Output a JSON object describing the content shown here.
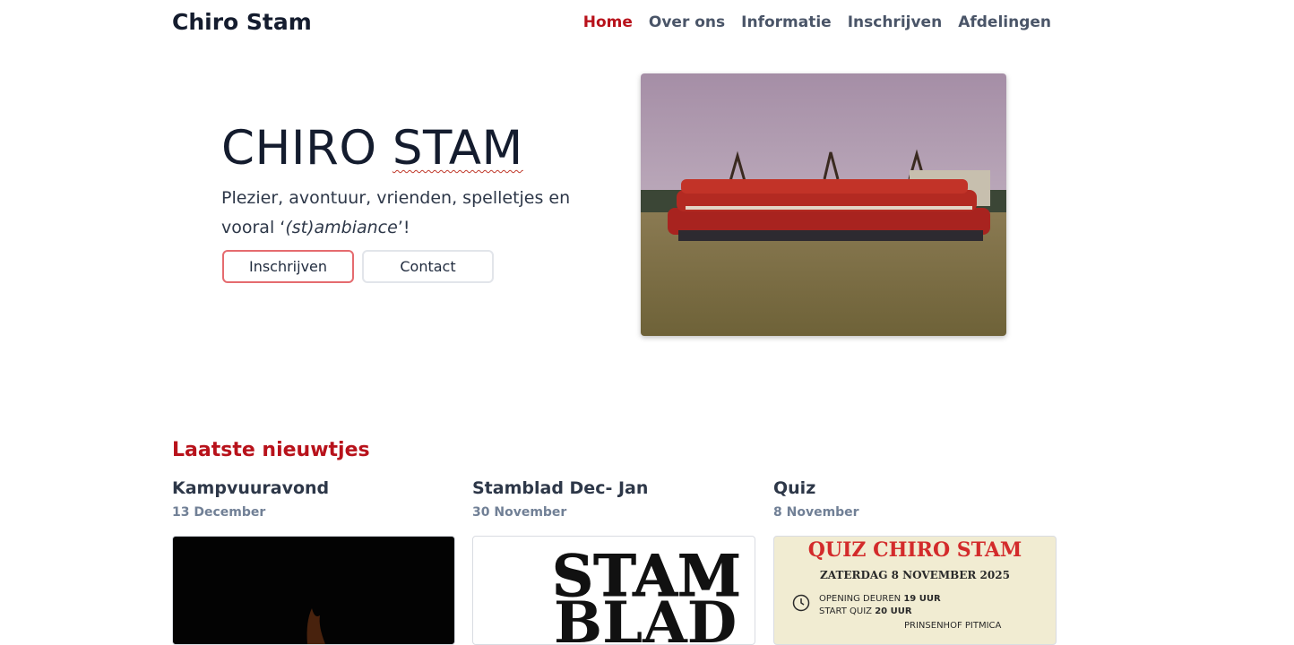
{
  "header": {
    "brand": "Chiro Stam",
    "nav": [
      {
        "label": "Home",
        "active": true
      },
      {
        "label": "Over ons"
      },
      {
        "label": "Informatie"
      },
      {
        "label": "Inschrijven"
      },
      {
        "label": "Afdelingen"
      }
    ]
  },
  "hero": {
    "title_part1": "CHIRO ",
    "title_part2": "STAM",
    "subtitle_start": "Plezier, avontuur, vrienden, spelletjes en vooral ‘",
    "subtitle_emphasis": "(st)ambiance",
    "subtitle_end": "’!",
    "primary_button": "Inschrijven",
    "secondary_button": "Contact"
  },
  "news": {
    "heading": "Laatste nieuwtjes",
    "items": [
      {
        "title": "Kampvuuravond",
        "date": "13 December"
      },
      {
        "title": "Stamblad Dec- Jan",
        "date": "30 November",
        "image_text": "STAMBLAD"
      },
      {
        "title": "Quiz",
        "date": "8 November",
        "poster": {
          "title": "QUIZ CHIRO STAM",
          "date": "ZATERDAG 8 NOVEMBER 2025",
          "line1_prefix": "OPENING DEUREN ",
          "line1_bold": "19 UUR",
          "line2_prefix": "START QUIZ ",
          "line2_bold": "20 UUR",
          "line3": "PRINSENHOF PITMICA"
        }
      }
    ]
  },
  "colors": {
    "accent": "#b8121b",
    "text": "#141c2e",
    "muted": "#718096"
  }
}
